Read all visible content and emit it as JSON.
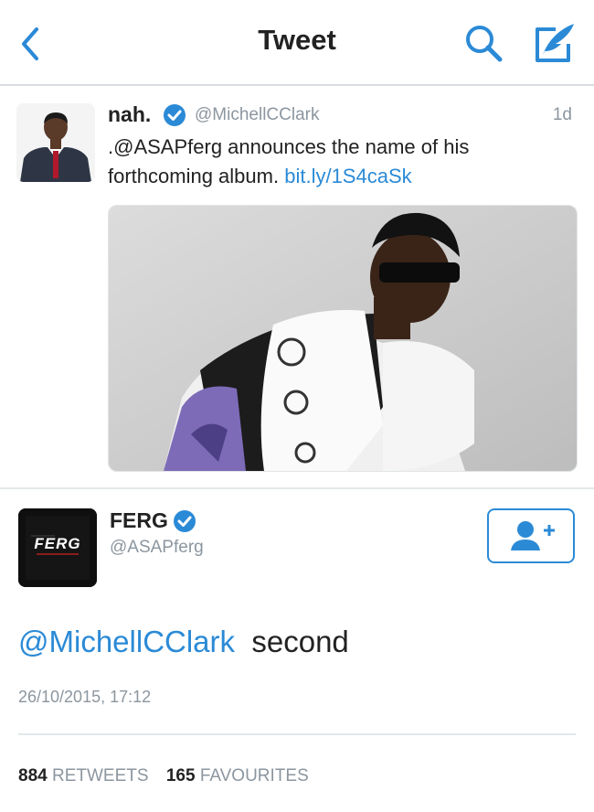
{
  "nav": {
    "title": "Tweet"
  },
  "quoted": {
    "name": "nah.",
    "handle": "@MichellCClark",
    "time": "1d",
    "text": ".@ASAPferg announces the name of his forthcoming album.",
    "link": "bit.ly/1S4caSk"
  },
  "author": {
    "name": "FERG",
    "handle": "@ASAPferg",
    "avatar_text": "FERG"
  },
  "tweet": {
    "mention": "@MichellCClark",
    "text": "second",
    "timestamp": "26/10/2015, 17:12"
  },
  "stats": {
    "retweets_count": "884",
    "retweets_label": "RETWEETS",
    "favourites_count": "165",
    "favourites_label": "FAVOURITES"
  },
  "colors": {
    "accent": "#2b8ad6",
    "muted": "#8c969f",
    "text": "#222222"
  }
}
